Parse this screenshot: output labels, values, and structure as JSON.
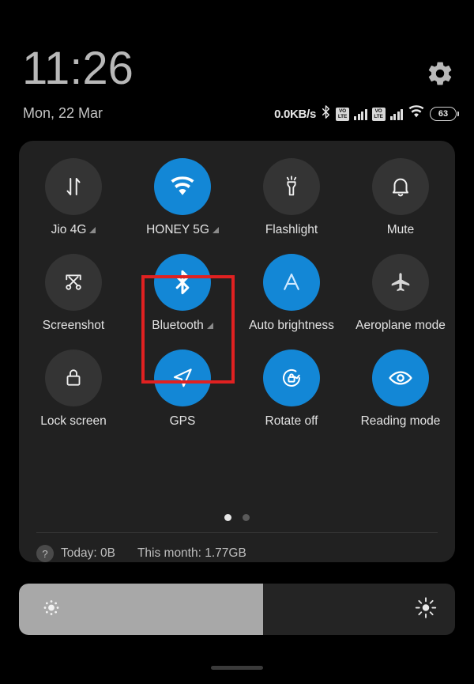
{
  "statusbar": {
    "clock": "11:26",
    "date": "Mon, 22 Mar",
    "network_speed": "0.0KB/s",
    "bluetooth_icon": "bluetooth-icon",
    "sim1_volte_top": "VO",
    "sim1_volte_bottom": "LTE",
    "sim2_volte_top": "VO",
    "sim2_volte_bottom": "LTE",
    "wifi_icon": "wifi-icon",
    "battery_level": "63",
    "settings_icon": "gear-icon"
  },
  "tiles": [
    {
      "label": "Jio 4G",
      "icon": "mobile-data-icon",
      "active": false,
      "expandable": true
    },
    {
      "label": "HONEY 5G",
      "icon": "wifi-icon",
      "active": true,
      "expandable": true
    },
    {
      "label": "Flashlight",
      "icon": "flashlight-icon",
      "active": false,
      "expandable": false
    },
    {
      "label": "Mute",
      "icon": "bell-icon",
      "active": false,
      "expandable": false
    },
    {
      "label": "Screenshot",
      "icon": "screenshot-icon",
      "active": false,
      "expandable": false
    },
    {
      "label": "Bluetooth",
      "icon": "bluetooth-icon",
      "active": true,
      "expandable": true
    },
    {
      "label": "Auto brightness",
      "icon": "auto-brightness-icon",
      "active": true,
      "expandable": false
    },
    {
      "label": "Aeroplane mode",
      "icon": "aeroplane-icon",
      "active": false,
      "expandable": false
    },
    {
      "label": "Lock screen",
      "icon": "lock-icon",
      "active": false,
      "expandable": false
    },
    {
      "label": "GPS",
      "icon": "navigation-arrow-icon",
      "active": true,
      "expandable": false
    },
    {
      "label": "Rotate off",
      "icon": "rotate-lock-icon",
      "active": true,
      "expandable": false
    },
    {
      "label": "Reading mode",
      "icon": "eye-icon",
      "active": true,
      "expandable": false
    }
  ],
  "pager": {
    "total": 2,
    "active_index": 0
  },
  "data_usage": {
    "help_icon": "?",
    "today": "Today: 0B",
    "this_month": "This month: 1.77GB"
  },
  "brightness": {
    "level_percent": 56,
    "low_icon": "brightness-low-icon",
    "high_icon": "brightness-high-icon"
  },
  "annotation": {
    "highlighted_tile": "Bluetooth",
    "color": "#e02121"
  },
  "colors": {
    "active_tile": "#1387d6",
    "inactive_tile": "#343434",
    "panel": "#212121",
    "background": "#000000"
  }
}
